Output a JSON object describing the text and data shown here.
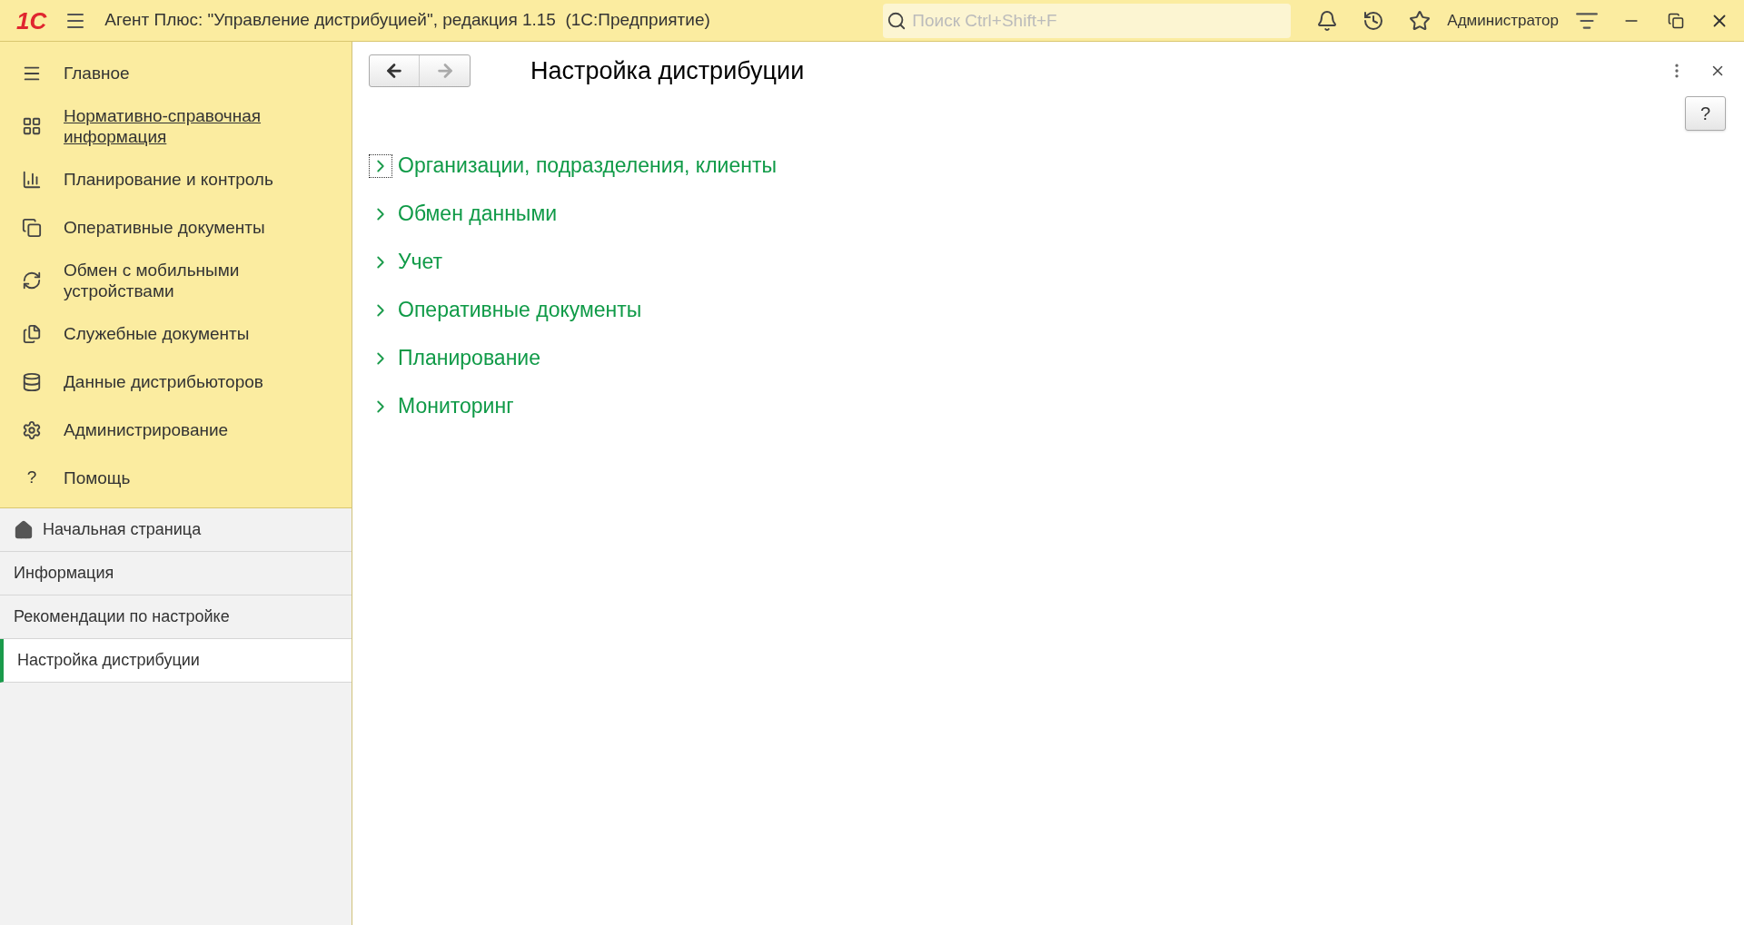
{
  "window": {
    "logo": "1С",
    "title": "Агент Плюс: \"Управление дистрибуцией\", редакция 1.15  (1С:Предприятие)",
    "search": {
      "placeholder": "Поиск Ctrl+Shift+F"
    },
    "user": "Администратор"
  },
  "sections_panel": {
    "items": [
      {
        "label": "Главное",
        "hovered": false
      },
      {
        "label": "Нормативно-справочная информация",
        "hovered": true
      },
      {
        "label": "Планирование и контроль",
        "hovered": false
      },
      {
        "label": "Оперативные документы",
        "hovered": false
      },
      {
        "label": "Обмен с мобильными устройствами",
        "hovered": false
      },
      {
        "label": "Служебные документы",
        "hovered": false
      },
      {
        "label": "Данные дистрибьюторов",
        "hovered": false
      },
      {
        "label": "Администрирование",
        "hovered": false
      },
      {
        "label": "Помощь",
        "hovered": false,
        "glyph": "?"
      }
    ]
  },
  "open_pages": {
    "items": [
      {
        "label": "Начальная страница",
        "kind": "home",
        "selected": false
      },
      {
        "label": "Информация",
        "kind": "page",
        "selected": false
      },
      {
        "label": "Рекомендации по настройке",
        "kind": "page",
        "selected": false
      },
      {
        "label": "Настройка дистрибуции",
        "kind": "page",
        "selected": true
      }
    ]
  },
  "form": {
    "title": "Настройка дистрибуции",
    "help_button": "?",
    "groups": [
      {
        "label": "Организации, подразделения, клиенты",
        "expanded": false,
        "focused": true
      },
      {
        "label": "Обмен данными",
        "expanded": false,
        "focused": false
      },
      {
        "label": "Учет",
        "expanded": false,
        "focused": false
      },
      {
        "label": "Оперативные документы",
        "expanded": false,
        "focused": false
      },
      {
        "label": "Планирование",
        "expanded": false,
        "focused": false
      },
      {
        "label": "Мониторинг",
        "expanded": false,
        "focused": false
      }
    ]
  }
}
